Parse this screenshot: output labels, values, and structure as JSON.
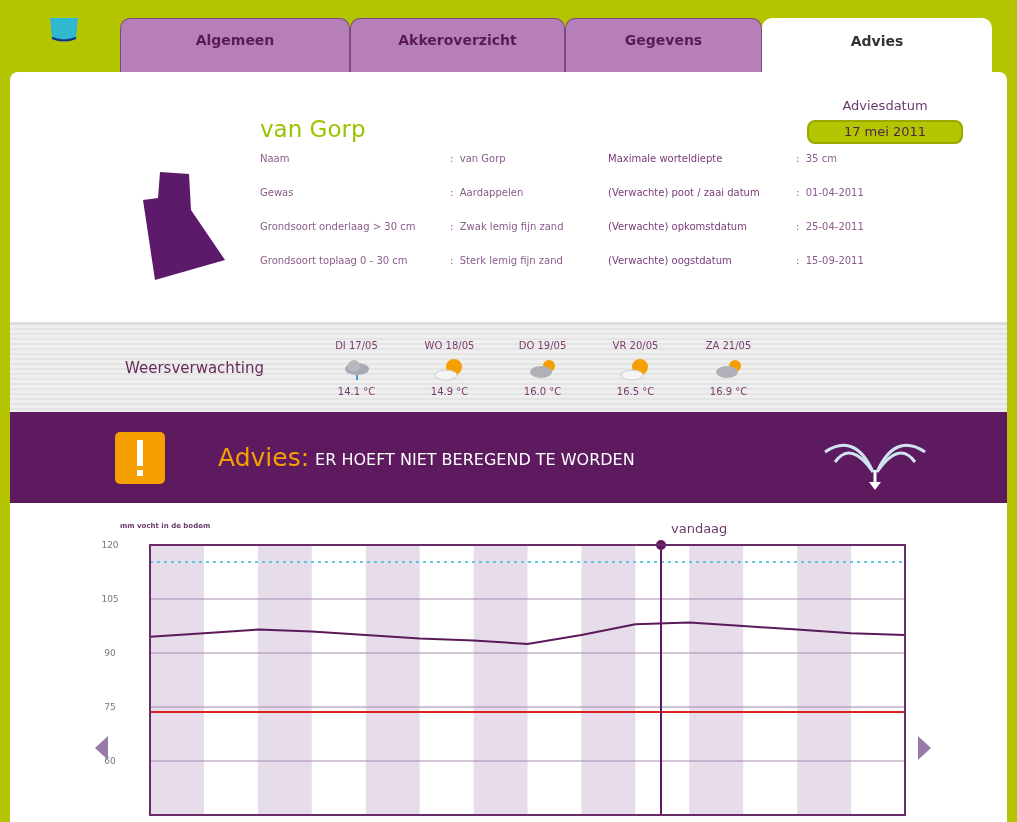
{
  "tabs": [
    {
      "label": "Algemeen",
      "selected": false
    },
    {
      "label": "Akkeroverzicht",
      "selected": false
    },
    {
      "label": "Gegevens",
      "selected": false
    },
    {
      "label": "Advies",
      "selected": true
    }
  ],
  "field": {
    "title": "van Gorp",
    "details_left": [
      {
        "label": "Naam",
        "value": ":  van Gorp"
      },
      {
        "label": "Gewas",
        "value": ":  Aardappelen"
      },
      {
        "label": "Grondsoort onderlaag > 30 cm",
        "value": ":  Zwak lemig fijn zand"
      },
      {
        "label": "Grondsoort toplaag 0 - 30 cm",
        "value": ":  Sterk lemig fijn zand"
      }
    ],
    "details_right": [
      {
        "label": "Maximale worteldiepte",
        "value": ":  35 cm"
      },
      {
        "label": "(Verwachte) poot / zaai datum",
        "value": ":  01-04-2011"
      },
      {
        "label": "(Verwachte) opkomstdatum",
        "value": ":  25-04-2011"
      },
      {
        "label": "(Verwachte) oogstdatum",
        "value": ":  15-09-2011"
      }
    ],
    "advice_date_label": "Adviesdatum",
    "advice_date": "17 mei 2011"
  },
  "weather": {
    "title": "Weersverwachting",
    "days": [
      {
        "day": "DI 17/05",
        "kind": "rain",
        "temp": "14.1 °C"
      },
      {
        "day": "WO 18/05",
        "kind": "sunny",
        "temp": "14.9 °C"
      },
      {
        "day": "DO 19/05",
        "kind": "cloudy",
        "temp": "16.0 °C"
      },
      {
        "day": "VR 20/05",
        "kind": "sunny",
        "temp": "16.5 °C"
      },
      {
        "day": "ZA 21/05",
        "kind": "cloudy",
        "temp": "16.9 °C"
      }
    ]
  },
  "advice": {
    "label": "Advies:",
    "text": "ER HOEFT NIET BEREGEND TE WORDEN"
  },
  "chart": {
    "today_label": "vandaag",
    "chart_data": {
      "type": "line",
      "ylabel": "mm vocht in de bodem",
      "categories": [
        null,
        null,
        null,
        null,
        null,
        null,
        null,
        null,
        null,
        null,
        null,
        null,
        null,
        null,
        null
      ],
      "series": [
        {
          "color": "#5a1a5a",
          "values": [
            94.5,
            95.5,
            96.5,
            96,
            95,
            94,
            93.5,
            92.5,
            95,
            98,
            98.5,
            97.5,
            96.5,
            95.5,
            95
          ]
        }
      ],
      "ylim": [
        45,
        120
      ],
      "yticks": [
        120,
        105,
        90,
        75,
        60
      ],
      "grid": true
    }
  }
}
